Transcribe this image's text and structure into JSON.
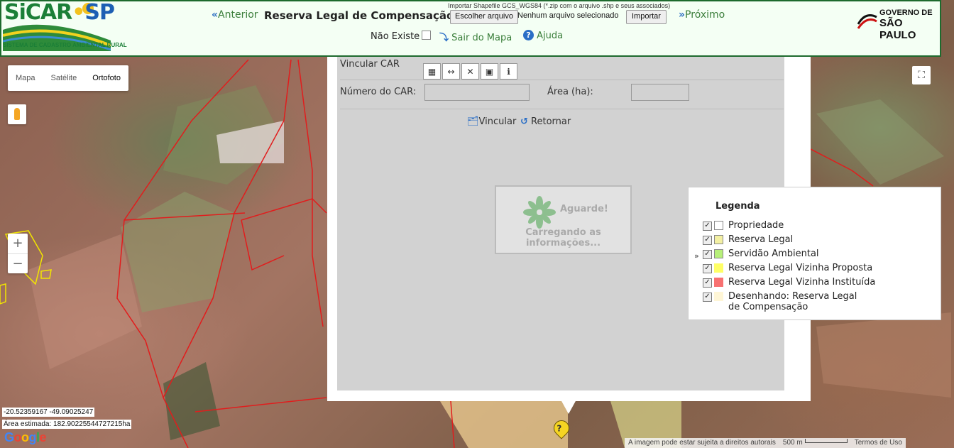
{
  "header": {
    "brand_sicar": "SiCAR",
    "brand_sp": "SP",
    "brand_sub": "SISTEMA DE CADASTRO AMBIENTAL RURAL",
    "prev_label": "Anterior",
    "title": "Reserva Legal de Compensação",
    "import_label": "Importar Shapefile GCS_WGS84 (*.zip com o arquivo .shp e seus associados)",
    "file_button": "Escolher arquivo",
    "file_none": "Nenhum arquivo selecionado",
    "import_button": "Importar",
    "next_label": "Próximo",
    "gov_line1": "GOVERNO DE",
    "gov_line2": "SÃO PAULO",
    "nao_existe": "Não Existe",
    "nao_existe_checked": false,
    "sair_label": "Sair do Mapa",
    "ajuda_label": "Ajuda"
  },
  "map_controls": {
    "map_types": [
      "Mapa",
      "Satélite",
      "Ortofoto"
    ],
    "active_map_type": "Ortofoto",
    "zoom_in": "+",
    "zoom_out": "−"
  },
  "panel": {
    "title": "Vincular CAR",
    "car_label": "Número do CAR:",
    "car_value": "",
    "area_label": "Área (ha):",
    "area_value": "",
    "vincular_label": "Vincular",
    "retornar_label": "Retornar",
    "toolbar_icons": [
      "measure-area-icon",
      "measure-distance-icon",
      "clear-icon",
      "save-icon",
      "info-icon"
    ]
  },
  "loading": {
    "aguarde": "Aguarde!",
    "message": "Carregando as informações..."
  },
  "legend": {
    "title": "Legenda",
    "items": [
      {
        "label": "Propriedade",
        "color": "#ffffff",
        "checked": true
      },
      {
        "label": "Reserva Legal",
        "color": "#f3f0a3",
        "checked": true
      },
      {
        "label": "Servidão Ambiental",
        "color": "#b7f07a",
        "checked": true
      },
      {
        "label": "Reserva Legal Vizinha Proposta",
        "color": "#ffff66",
        "checked": true
      },
      {
        "label": "Reserva Legal Vizinha Instituída",
        "color": "#f87171",
        "checked": true
      },
      {
        "label": "Desenhando: Reserva Legal de Compensação",
        "color": "#fff6d6",
        "checked": true
      }
    ],
    "active_marker": "»"
  },
  "footer": {
    "coords": "-20.52359167 -49.09025247",
    "area_estimada": "Área estimada: 182.90225544727215ha",
    "attribution": "A imagem pode estar sujeita a direitos autorais",
    "scale": "500 m",
    "terms": "Termos de Uso"
  },
  "colors": {
    "header_bg": "#f4fff4",
    "header_border": "#1d6a2d",
    "link_green": "#3a7e3a",
    "icon_blue": "#2a6ec6",
    "polygon_red": "#e11d1d"
  }
}
